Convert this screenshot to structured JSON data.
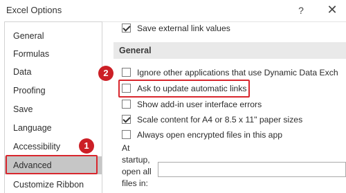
{
  "window": {
    "title": "Excel Options",
    "help_glyph": "?",
    "close_glyph": "✕"
  },
  "sidebar": {
    "items": [
      {
        "label": "General"
      },
      {
        "label": "Formulas"
      },
      {
        "label": "Data"
      },
      {
        "label": "Proofing"
      },
      {
        "label": "Save"
      },
      {
        "label": "Language"
      },
      {
        "label": "Accessibility"
      },
      {
        "label": "Advanced",
        "selected": true
      },
      {
        "label": "Customize Ribbon"
      }
    ]
  },
  "content": {
    "save_external": {
      "label": "Save external link values",
      "checked": true
    },
    "general_section": {
      "title": "General",
      "options": [
        {
          "label": "Ignore other applications that use Dynamic Data Exch",
          "checked": false
        },
        {
          "label": "Ask to update automatic links",
          "checked": false
        },
        {
          "label": "Show add-in user interface errors",
          "checked": false
        },
        {
          "label": "Scale content for A4 or 8.5 x 11\" paper sizes",
          "checked": true
        },
        {
          "label": "Always open encrypted files in this app",
          "checked": false
        }
      ],
      "startup_label": "At startup, open all files in:",
      "startup_value": ""
    }
  },
  "annotations": {
    "badge_1": "1",
    "badge_2": "2",
    "highlight_color": "#d8262d"
  }
}
